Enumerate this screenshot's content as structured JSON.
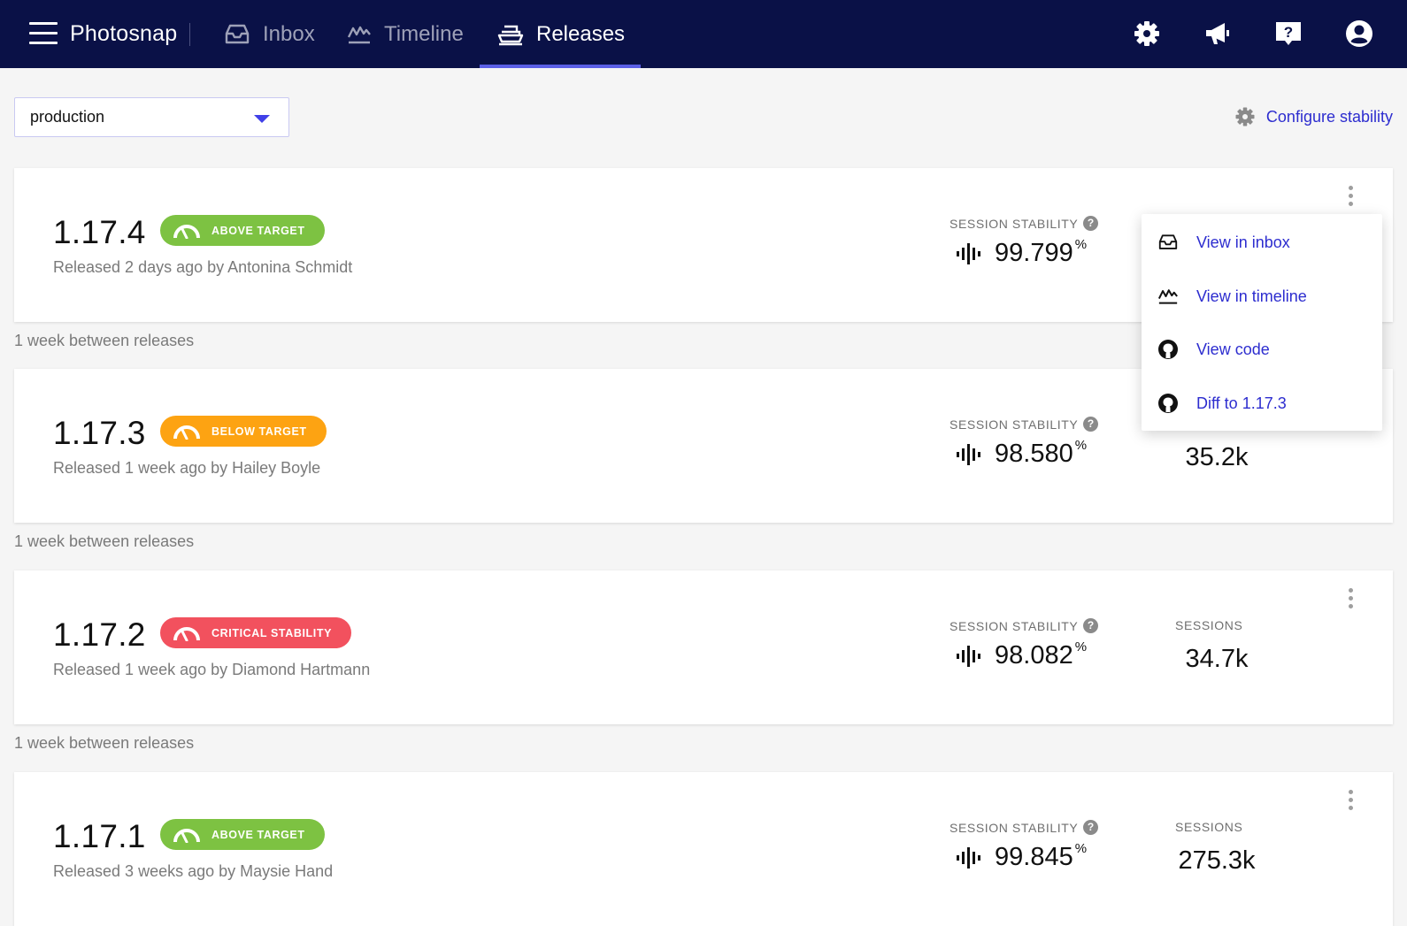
{
  "nav": {
    "brand": "Photosnap",
    "tabs": [
      {
        "label": "Inbox",
        "icon": "inbox-icon",
        "active": false
      },
      {
        "label": "Timeline",
        "icon": "timeline-icon",
        "active": false
      },
      {
        "label": "Releases",
        "icon": "releases-icon",
        "active": true
      }
    ],
    "right_icons": [
      "settings-icon",
      "announcement-icon",
      "help-icon",
      "user-icon"
    ]
  },
  "toolbar": {
    "environment": "production",
    "configure_label": "Configure stability"
  },
  "labels": {
    "session_stability": "SESSION STABILITY",
    "sessions": "SESSIONS",
    "percent": "%"
  },
  "releases": [
    {
      "version": "1.17.4",
      "badge": "ABOVE TARGET",
      "badge_status": "above",
      "released": "Released 2 days ago by Antonina Schmidt",
      "stability": "99.799",
      "sessions": ""
    },
    {
      "version": "1.17.3",
      "badge": "BELOW TARGET",
      "badge_status": "below",
      "released": "Released 1 week ago by Hailey Boyle",
      "stability": "98.580",
      "sessions": "35.2k"
    },
    {
      "version": "1.17.2",
      "badge": "CRITICAL STABILITY",
      "badge_status": "critical",
      "released": "Released 1 week ago by Diamond Hartmann",
      "stability": "98.082",
      "sessions": "34.7k"
    },
    {
      "version": "1.17.1",
      "badge": "ABOVE TARGET",
      "badge_status": "above",
      "released": "Released 3 weeks ago by Maysie Hand",
      "stability": "99.845",
      "sessions": "275.3k"
    }
  ],
  "between_releases": [
    "1 week between releases",
    "1 week between releases",
    "1 week between releases"
  ],
  "context_menu": {
    "items": [
      {
        "label": "View in inbox",
        "icon": "inbox-icon"
      },
      {
        "label": "View in timeline",
        "icon": "timeline-icon"
      },
      {
        "label": "View code",
        "icon": "github-icon"
      },
      {
        "label": "Diff to 1.17.3",
        "icon": "github-icon"
      }
    ]
  },
  "colors": {
    "nav_bg": "#0a1147",
    "accent": "#5b5fe6",
    "link": "#2d2dcf",
    "above_target": "#7dc242",
    "below_target": "#fda312",
    "critical": "#f2515e"
  }
}
